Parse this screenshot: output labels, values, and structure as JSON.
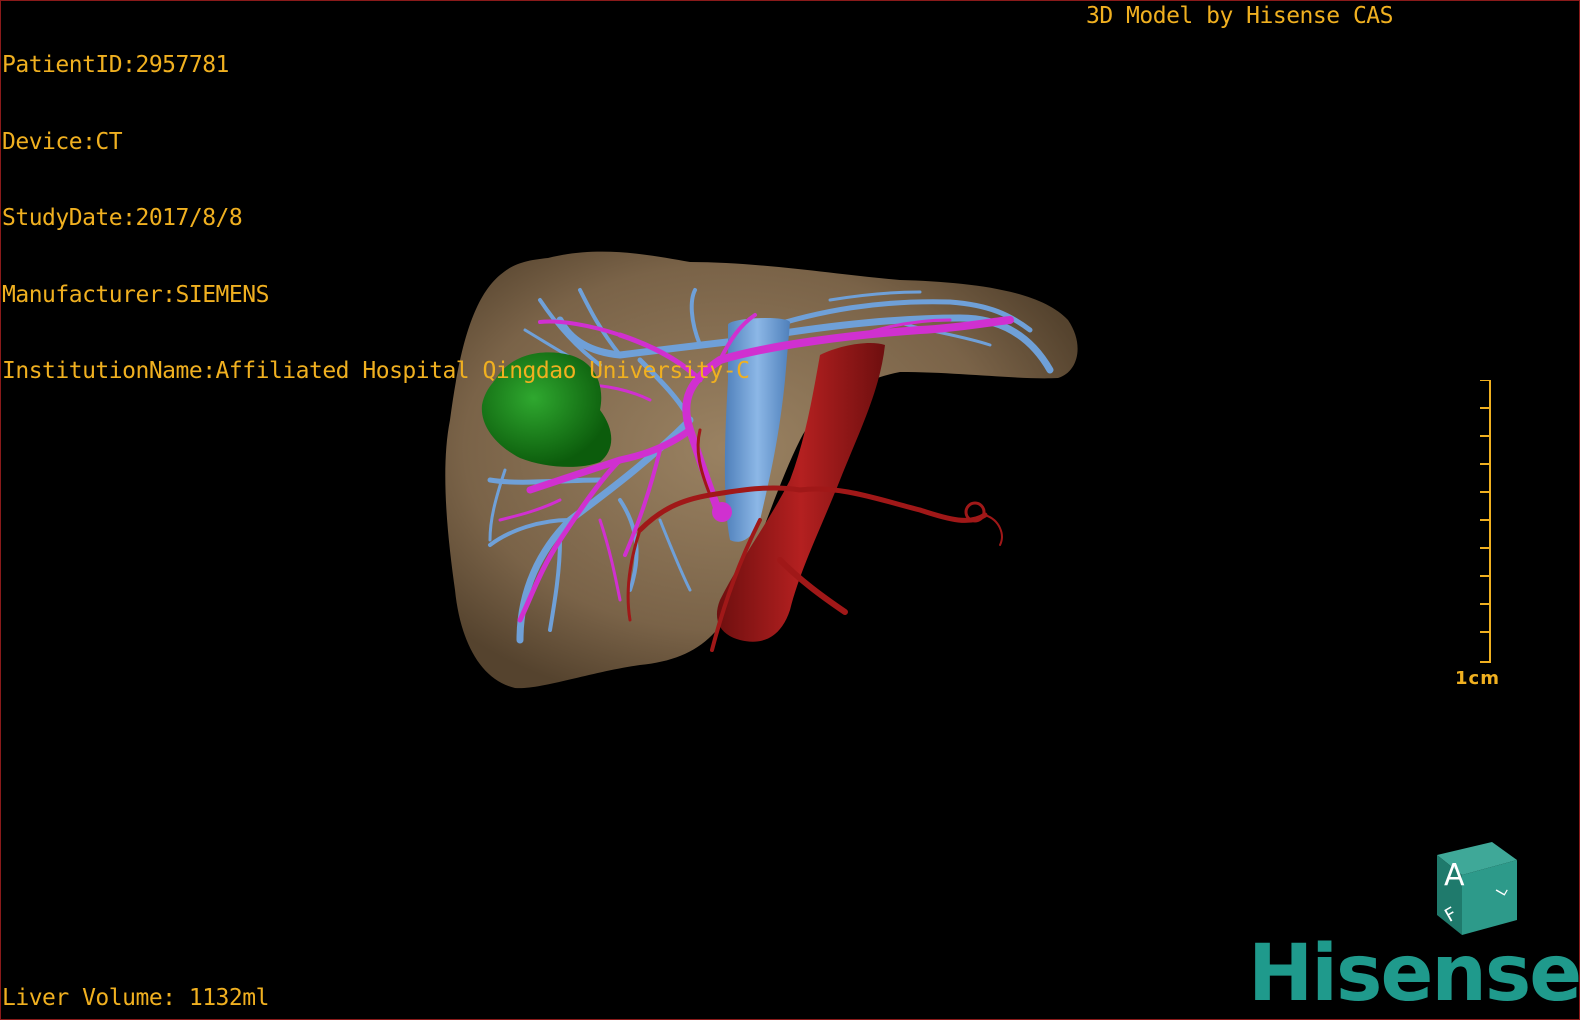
{
  "header": {
    "patient_id": "PatientID:2957781",
    "device": "Device:CT",
    "study_date": "StudyDate:2017/8/8",
    "manufacturer": "Manufacturer:SIEMENS",
    "institution": "InstitutionName:Affiliated Hospital Qingdao University-C"
  },
  "brand_text": "3D Model by Hisense CAS",
  "footer": {
    "liver_volume": "Liver Volume: 1132ml"
  },
  "scale": {
    "label": "1cm"
  },
  "orientation_cube": {
    "front_face": "A",
    "top_face": "F",
    "side_face": "L"
  },
  "logo": {
    "text": "Hisense"
  },
  "colors": {
    "overlay_text": "#f0b020",
    "liver": "#8a7354",
    "tumor": "#1a8a1a",
    "hepatic_vein": "#6fa0d8",
    "portal_vein": "#d030d0",
    "artery": "#a01818",
    "brand": "#1f9a8c"
  },
  "icons": {
    "orientation": "orientation-cube-icon",
    "scale": "scale-bar-icon"
  }
}
